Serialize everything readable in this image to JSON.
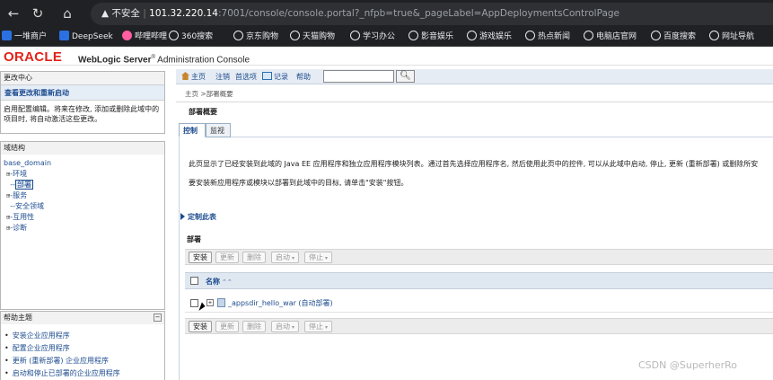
{
  "browser": {
    "back_icon": "arrow-left-icon",
    "forward_icon": "arrow-right-icon",
    "reload_icon": "reload-icon",
    "home_icon": "home-icon",
    "security_label": "不安全",
    "url_host": "101.32.220.14",
    "url_path": ":7001/console/console.portal?_nfpb=true&_pageLabel=AppDeploymentsControlPage",
    "bookmarks": [
      "一堆商户",
      "DeepSeek",
      "哔哩哔哩",
      "360搜索",
      "京东购物",
      "天猫购物",
      "学习办公",
      "影音娱乐",
      "游戏娱乐",
      "热点新闻",
      "电脑店官网",
      "百度搜索",
      "网址导航"
    ]
  },
  "header": {
    "oracle": "ORACLE",
    "product": "WebLogic Server",
    "reg": "®",
    "subtitle": "Administration Console"
  },
  "change_center": {
    "title": "更改中心",
    "link": "查看更改和重新启动",
    "text": "启用配置编辑。将来在修改, 添加或删除此域中的项目时, 将自动激活这些更改。"
  },
  "domain_structure": {
    "title": "域结构",
    "root": "base_domain",
    "nodes": [
      "环境",
      "部署",
      "服务",
      "安全领域",
      "互用性",
      "诊断"
    ]
  },
  "help_topics": {
    "title": "帮助主题",
    "items": [
      "安装企业应用程序",
      "配置企业应用程序",
      "更新 (重新部署) 企业应用程序",
      "启动和停止已部署的企业应用程序"
    ]
  },
  "toolbar": {
    "home": "主页",
    "logout": "注销",
    "preferences": "首选项",
    "record": "记录",
    "help": "帮助",
    "search_placeholder": ""
  },
  "breadcrumb": "主页 >部署概要",
  "section_title": "部署概要",
  "tabs": [
    "控制",
    "监视"
  ],
  "description": {
    "line1": "此页显示了已经安装到此域的 Java EE 应用程序和独立应用程序模块列表。通过首先选择应用程序名, 然后使用此页中的控件, 可以从此域中启动, 停止, 更新 (重新部署) 或删除所安",
    "line2": "要安装新应用程序或模块以部署到此域中的目标, 请单击\"安装\"按钮。"
  },
  "customize_link": "定制此表",
  "deployments": {
    "label": "部署",
    "buttons": {
      "install": "安装",
      "update": "更新",
      "delete": "删除",
      "start": "启动",
      "stop": "停止"
    },
    "column_name": "名称",
    "rows": [
      {
        "name": "_appsdir_hello_war (自动部署)"
      }
    ]
  },
  "watermark": "CSDN @SuperherRo"
}
